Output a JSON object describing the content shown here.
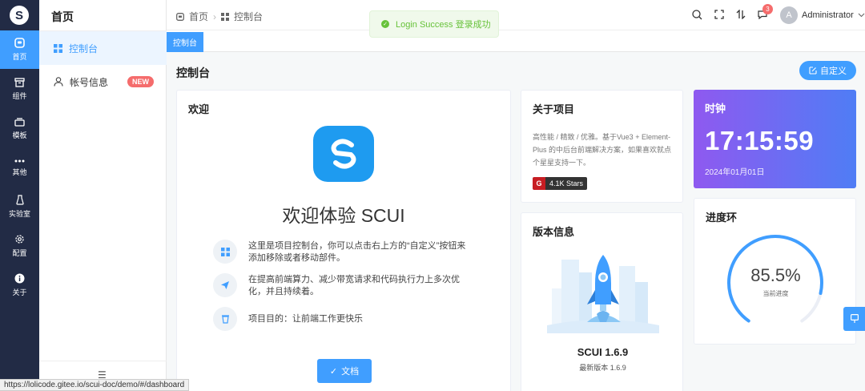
{
  "nav": {
    "logo": "S",
    "items": [
      {
        "label": "首页",
        "icon": "home-icon"
      },
      {
        "label": "组件",
        "icon": "archive-icon"
      },
      {
        "label": "模板",
        "icon": "template-icon"
      },
      {
        "label": "其他",
        "icon": "more-icon"
      },
      {
        "label": "实验室",
        "icon": "flask-icon"
      },
      {
        "label": "配置",
        "icon": "gear-icon"
      },
      {
        "label": "关于",
        "icon": "info-icon"
      }
    ]
  },
  "sidebar": {
    "title": "首页",
    "items": [
      {
        "label": "控制台",
        "icon": "grid-icon"
      },
      {
        "label": "帐号信息",
        "icon": "user-icon",
        "badge": "NEW"
      }
    ]
  },
  "header": {
    "breadcrumb": [
      "首页",
      "控制台"
    ],
    "notification_count": "3",
    "user_initial": "A",
    "user_name": "Administrator"
  },
  "tabs": [
    "控制台"
  ],
  "toast": {
    "text": "Login Success 登录成功"
  },
  "page": {
    "title": "控制台",
    "custom_button": "自定义"
  },
  "welcome": {
    "title": "欢迎",
    "heading": "欢迎体验 SCUI",
    "features": [
      {
        "text": "这里是项目控制台，你可以点击右上方的“自定义”按钮来添加移除或者移动部件。",
        "icon": "grid-icon"
      },
      {
        "text": "在提高前端算力、减少带宽请求和代码执行力上多次优化，并且持续着。",
        "icon": "send-icon"
      },
      {
        "text": "项目目的：让前端工作更快乐",
        "icon": "cup-icon"
      }
    ],
    "doc_button": "文档"
  },
  "about": {
    "title": "关于项目",
    "text": "高性能 / 精致 / 优雅。基于Vue3 + Element-Plus 的中后台前端解决方案，如果喜欢就点个星星支持一下。",
    "stars_icon": "G",
    "stars": "4.1K Stars"
  },
  "version": {
    "title": "版本信息",
    "name": "SCUI 1.6.9",
    "latest": "最新版本 1.6.9"
  },
  "clock": {
    "title": "时钟",
    "time": "17:15:59",
    "date": "2024年01月01日"
  },
  "progress": {
    "title": "进度环",
    "value": 85.5,
    "label": "85.5%",
    "sub": "当前进度"
  },
  "statusbar": {
    "url": "https://lolicode.gitee.io/scui-doc/demo/#/dashboard"
  },
  "colors": {
    "primary": "#409eff",
    "nav_bg": "#222b45",
    "success": "#67c23a",
    "danger": "#f56c6c"
  }
}
